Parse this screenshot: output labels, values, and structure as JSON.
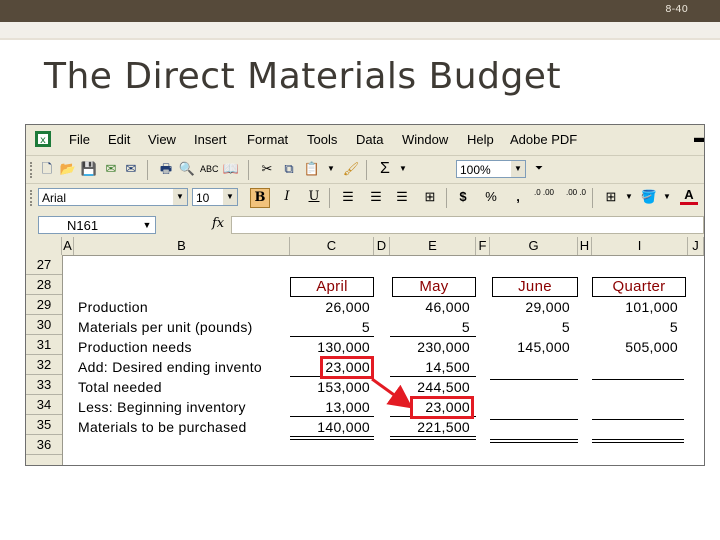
{
  "slide": {
    "page_number": "8-40",
    "title": "The Direct Materials Budget"
  },
  "menu": [
    "File",
    "Edit",
    "View",
    "Insert",
    "Format",
    "Tools",
    "Data",
    "Window",
    "Help",
    "Adobe PDF"
  ],
  "toolbar": {
    "zoom": "100%",
    "font_name": "Arial",
    "font_size": "10",
    "bold": "B",
    "italic": "I",
    "underline": "U",
    "sigma": "Σ",
    "currency": "$",
    "percent": "%",
    "comma": ",",
    "inc_decimal": ".0 .00",
    "dec_decimal": ".00 .0"
  },
  "formula_bar": {
    "cell_ref": "N161",
    "fx": "fx"
  },
  "columns": [
    "A",
    "B",
    "C",
    "D",
    "E",
    "F",
    "G",
    "H",
    "I",
    "J"
  ],
  "rows": [
    "27",
    "28",
    "29",
    "30",
    "31",
    "32",
    "33",
    "34",
    "35",
    "36"
  ],
  "table": {
    "headers": [
      "April",
      "May",
      "June",
      "Quarter"
    ],
    "lines": [
      {
        "label": "Production",
        "values": [
          "26,000",
          "46,000",
          "29,000",
          "101,000"
        ]
      },
      {
        "label": "Materials per unit (pounds)",
        "values": [
          "5",
          "5",
          "5",
          "5"
        ]
      },
      {
        "label": "Production needs",
        "values": [
          "130,000",
          "230,000",
          "145,000",
          "505,000"
        ]
      },
      {
        "label": "Add: Desired ending invento",
        "values": [
          "23,000",
          "14,500",
          "",
          ""
        ]
      },
      {
        "label": "Total needed",
        "values": [
          "153,000",
          "244,500",
          "",
          ""
        ]
      },
      {
        "label": "Less: Beginning inventory",
        "values": [
          "13,000",
          "23,000",
          "",
          ""
        ]
      },
      {
        "label": "Materials to be purchased",
        "values": [
          "140,000",
          "221,500",
          "",
          ""
        ]
      }
    ]
  },
  "colors": {
    "highlight": "#e31b23",
    "header_text": "#8b0000",
    "topbar": "#564a3a"
  }
}
